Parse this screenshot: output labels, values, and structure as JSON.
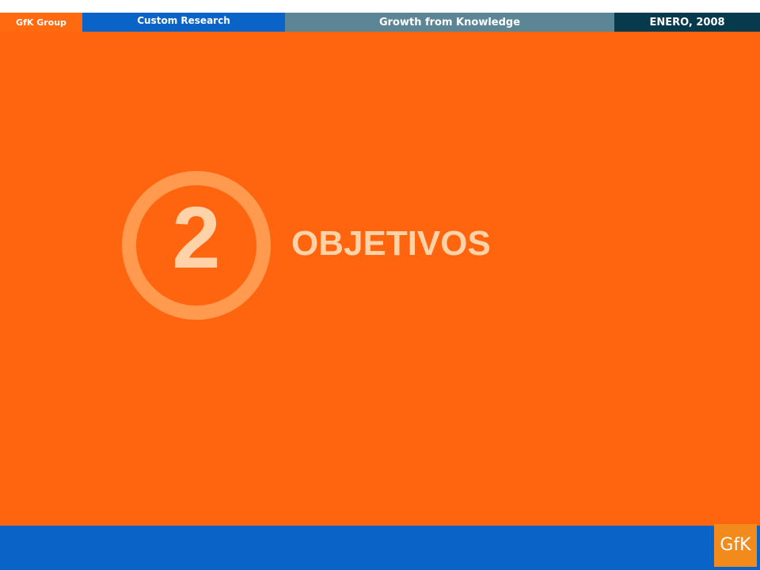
{
  "header": {
    "group_label": "GfK Group",
    "division_label": "Custom Research",
    "tagline": "Growth from Knowledge",
    "date": "ENERO, 2008"
  },
  "section": {
    "number": "2",
    "title": "OBJETIVOS"
  },
  "footer": {
    "logo_text": "GfK"
  },
  "colors": {
    "background_orange": "#ff650e",
    "accent_blue": "#0a64c8",
    "tagline_gray": "#5c8696",
    "date_navy": "#083a4e",
    "ring_light_orange": "#ff9a4f",
    "text_peach": "#ffd2a8",
    "logo_orange": "#f28a1c"
  }
}
